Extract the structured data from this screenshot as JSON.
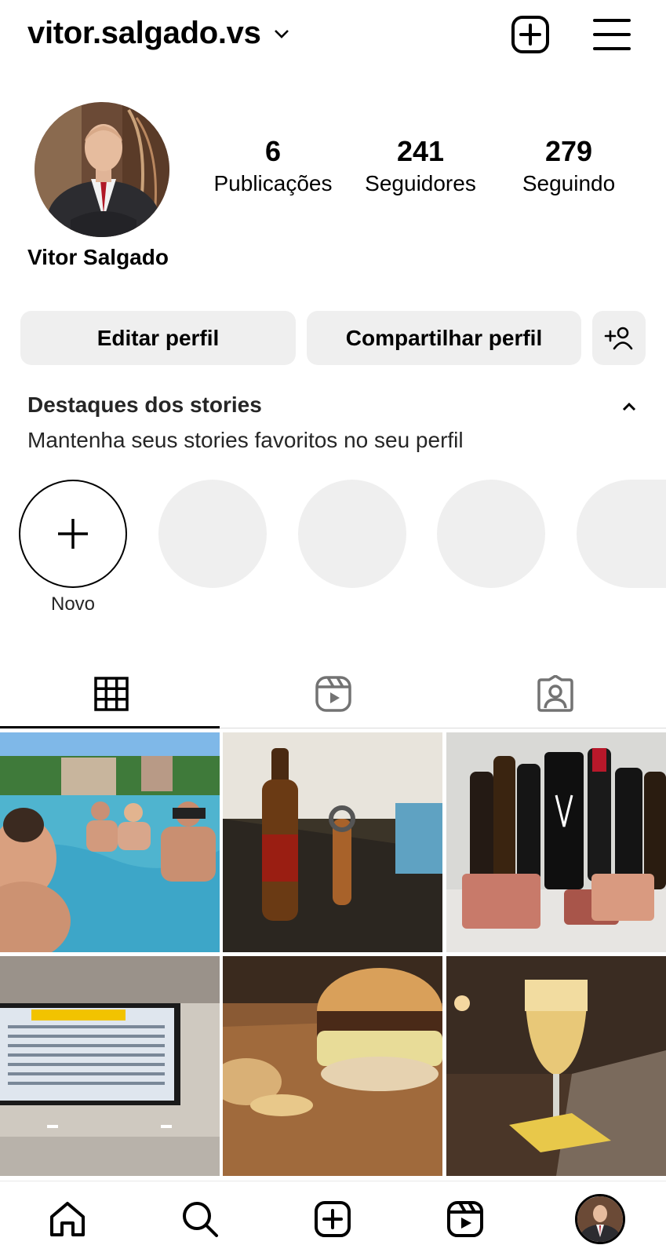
{
  "header": {
    "username": "vitor.salgado.vs",
    "add_icon": "plus-square-icon",
    "menu_icon": "hamburger-menu-icon"
  },
  "profile": {
    "full_name": "Vitor Salgado",
    "stats": {
      "posts": {
        "value": "6",
        "label": "Publicações"
      },
      "followers": {
        "value": "241",
        "label": "Seguidores"
      },
      "following": {
        "value": "279",
        "label": "Seguindo"
      }
    }
  },
  "actions": {
    "edit": "Editar perfil",
    "share": "Compartilhar perfil",
    "add_user_icon": "person-plus-icon"
  },
  "highlights": {
    "title": "Destaques dos stories",
    "subtitle": "Mantenha seus stories favoritos no seu perfil",
    "new_label": "Novo"
  },
  "tabs": [
    {
      "icon": "grid-icon",
      "active": true
    },
    {
      "icon": "reels-icon",
      "active": false
    },
    {
      "icon": "tagged-icon",
      "active": false
    }
  ],
  "posts": [
    "pool-photo",
    "beer-bottle-photo",
    "wine-bottles-photo",
    "airport-board-photo",
    "burger-photo",
    "beer-glass-photo"
  ],
  "bottom_nav": [
    "home-icon",
    "search-icon",
    "create-icon",
    "reels-icon",
    "profile-avatar"
  ],
  "colors": {
    "button_bg": "#efefef",
    "placeholder": "#efefef",
    "divider": "#dbdbdb"
  }
}
